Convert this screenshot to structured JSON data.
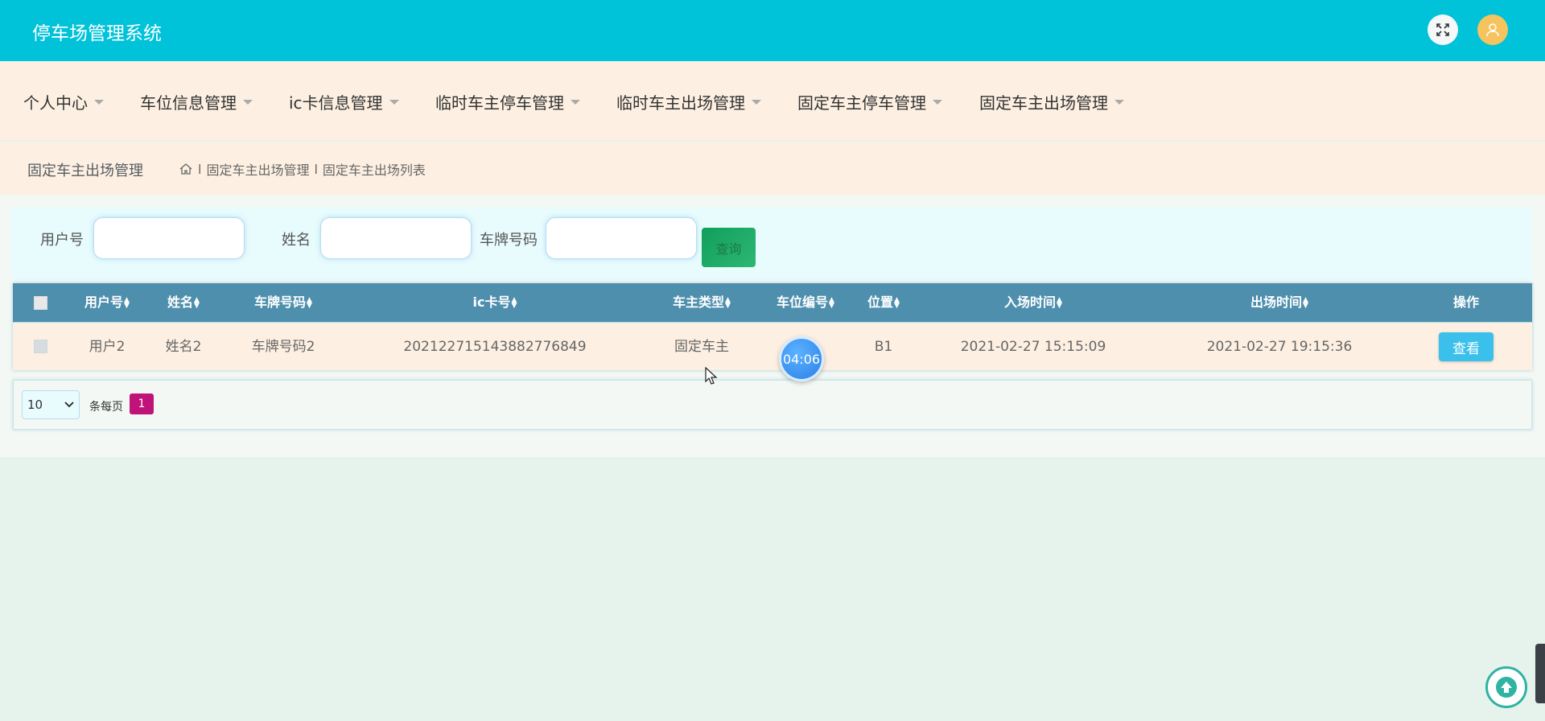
{
  "header": {
    "title": "停车场管理系统",
    "fullscreen_icon": "fullscreen-icon",
    "avatar_icon": "user-icon"
  },
  "nav": {
    "items": [
      {
        "label": "个人中心"
      },
      {
        "label": "车位信息管理"
      },
      {
        "label": "ic卡信息管理"
      },
      {
        "label": "临时车主停车管理"
      },
      {
        "label": "临时车主出场管理"
      },
      {
        "label": "固定车主停车管理"
      },
      {
        "label": "固定车主出场管理"
      }
    ]
  },
  "breadcrumb": {
    "title": "固定车主出场管理",
    "sep": "l",
    "items": [
      "固定车主出场管理",
      "固定车主出场列表"
    ]
  },
  "search": {
    "user_label": "用户号",
    "name_label": "姓名",
    "plate_label": "车牌号码",
    "button_label": "查询"
  },
  "table": {
    "headers": [
      "用户号",
      "姓名",
      "车牌号码",
      "ic卡号",
      "车主类型",
      "车位编号",
      "位置",
      "入场时间",
      "出场时间",
      "操作"
    ],
    "rows": [
      {
        "user": "用户2",
        "name": "姓名2",
        "plate": "车牌号码2",
        "card": "20212271514388277684 9",
        "card_full": "202122715143882776849",
        "owner_type": "固定车主",
        "spot": "",
        "location": "B1",
        "in_time": "2021-02-27 15:15:09",
        "out_time": "2021-02-27 19:15:36",
        "action": "查看"
      }
    ]
  },
  "pager": {
    "page_size": "10",
    "per_page_label": "条每页",
    "current_page": "1"
  },
  "timer": {
    "text": "04:06"
  },
  "colors": {
    "topbar": "#00c2d9",
    "table_header": "#4f8fae",
    "page_active": "#c0137a",
    "view_button": "#3bc0ec"
  }
}
